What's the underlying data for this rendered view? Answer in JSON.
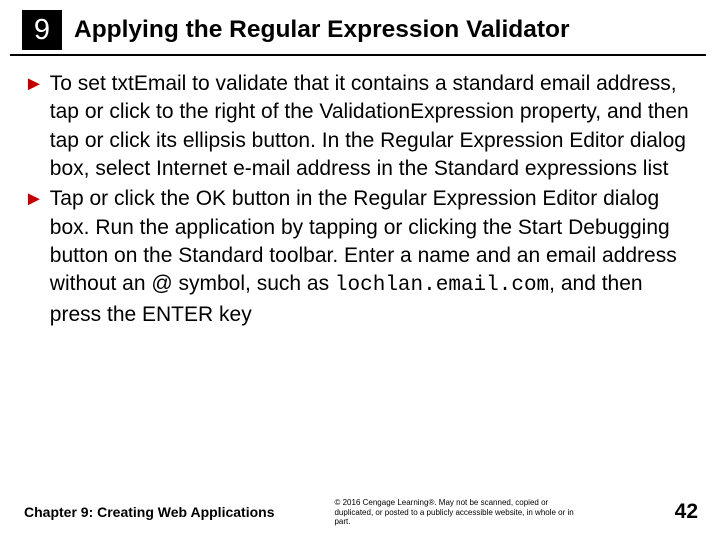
{
  "header": {
    "chapterNumber": "9",
    "title": "Applying the Regular Expression Validator"
  },
  "bullets": [
    {
      "pre": "To set txtEmail to validate that it contains a standard email address, tap or click to the right of the ValidationExpression property, and then tap or click its ellipsis button. In the Regular Expression Editor dialog box, select Internet e-mail address in the Standard expressions list",
      "code": "",
      "post": ""
    },
    {
      "pre": "Tap or click the OK button in the Regular Expression Editor dialog box. Run the application by tapping or clicking the Start Debugging button on the Standard toolbar. Enter a name and an email address without an @ symbol, such as ",
      "code": "lochlan.email.com",
      "post": ", and then press the ENTER key"
    }
  ],
  "footer": {
    "left": "Chapter 9: Creating Web Applications",
    "copyright": "© 2016 Cengage Learning®. May not be scanned, copied or duplicated, or posted to a publicly accessible website, in whole or in part.",
    "pageNumber": "42"
  }
}
